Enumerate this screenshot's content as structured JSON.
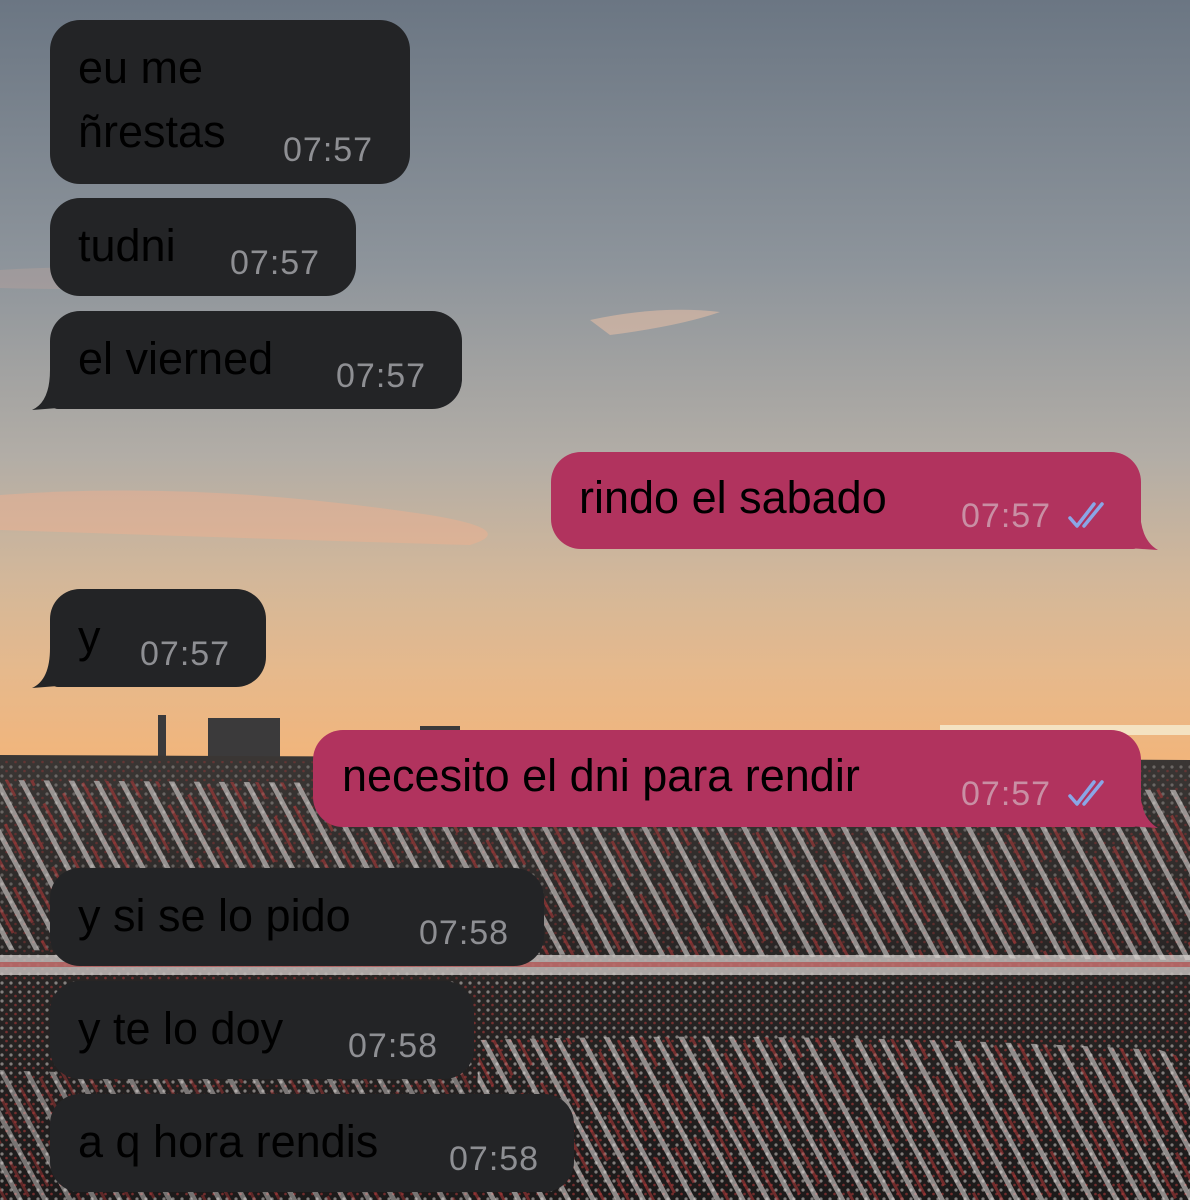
{
  "theme": {
    "incoming_bubble": "#232426",
    "outgoing_bubble": "#b1335e",
    "read_ticks": "#8aa6e6",
    "time_incoming": "#8e8f93",
    "time_outgoing": "#c98fa4"
  },
  "wallpaper": {
    "description_icon": "stadium-sunset-wallpaper",
    "sky_colors": [
      "#6f7a86",
      "#9aa0a4",
      "#c8b49a",
      "#e7b784",
      "#f0b277"
    ]
  },
  "messages": [
    {
      "direction": "incoming",
      "text": "eu me\nñrestas",
      "time": "07:57"
    },
    {
      "direction": "incoming",
      "text": "tudni",
      "time": "07:57"
    },
    {
      "direction": "incoming",
      "text": "el vierned",
      "time": "07:57"
    },
    {
      "direction": "outgoing",
      "text": "rindo el sabado",
      "time": "07:57",
      "status": "read"
    },
    {
      "direction": "incoming",
      "text": "y",
      "time": "07:57"
    },
    {
      "direction": "outgoing",
      "text": "necesito el dni para rendir",
      "time": "07:57",
      "status": "read"
    },
    {
      "direction": "incoming",
      "text": "y si se lo pido",
      "time": "07:58"
    },
    {
      "direction": "incoming",
      "text": "y te lo doy",
      "time": "07:58"
    },
    {
      "direction": "incoming",
      "text": "a q hora rendis",
      "time": "07:58"
    }
  ]
}
